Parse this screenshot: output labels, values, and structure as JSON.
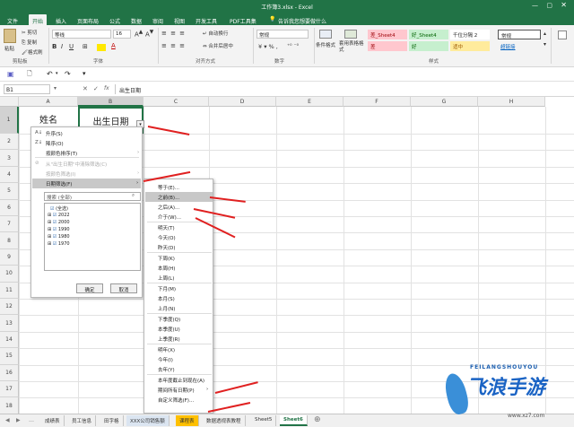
{
  "title": "工作簿3.xlsx - Excel",
  "menu": [
    "文件",
    "开始",
    "插入",
    "页面布局",
    "公式",
    "数据",
    "审阅",
    "视图",
    "开发工具",
    "PDF工具集"
  ],
  "tell_me": "告诉我您想要做什么",
  "ribbon": {
    "paste": "粘贴",
    "cut": "剪切",
    "copy": "复制",
    "format_painter": "格式刷",
    "clipboard": "剪贴板",
    "font_name": "等线",
    "font_size": "16",
    "font_group": "字体",
    "wrap": "自动换行",
    "merge": "合并后居中",
    "align_group": "对齐方式",
    "number_format": "常规",
    "number_group": "数字",
    "cond_format": "条件格式",
    "table_format": "套用表格格式",
    "styles_group": "样式",
    "styles": [
      "差_Sheet4",
      "好_Sheet4",
      "千位分隔 2",
      "常规",
      "差",
      "好",
      "适中",
      "超链接"
    ]
  },
  "name_box": "B1",
  "formula": "出生日期",
  "columns": [
    "A",
    "B",
    "C",
    "D",
    "E",
    "F",
    "G",
    "H"
  ],
  "rows": [
    "1",
    "2",
    "3",
    "4",
    "5",
    "6",
    "7",
    "8",
    "9",
    "10",
    "11",
    "12",
    "13",
    "14",
    "15",
    "16",
    "17",
    "18"
  ],
  "cells": {
    "a1": "姓名",
    "b1": "出生日期"
  },
  "filter_menu": {
    "sort_asc": "升序(S)",
    "sort_desc": "降序(O)",
    "sort_color": "按颜色排序(T)",
    "clear": "从\"出生日期\"中清除筛选(C)",
    "color_filter": "按颜色筛选(I)",
    "date_filter": "日期筛选(F)",
    "search_placeholder": "搜索 (全部)",
    "list": [
      "(全选)",
      "2022",
      "2000",
      "1990",
      "1980",
      "1970"
    ],
    "ok": "确定",
    "cancel": "取消"
  },
  "date_submenu": [
    "等于(E)...",
    "之前(B)...",
    "之后(A)...",
    "介于(W)...",
    "明天(T)",
    "今天(O)",
    "昨天(D)",
    "下周(K)",
    "本周(H)",
    "上周(L)",
    "下月(M)",
    "本月(S)",
    "上月(N)",
    "下季度(Q)",
    "本季度(U)",
    "上季度(R)",
    "明年(X)",
    "今年(I)",
    "去年(Y)",
    "本年度截止到现在(A)",
    "期间所有日期(P)",
    "自定义筛选(F)..."
  ],
  "sheet_tabs": [
    "成绩表",
    "员工信息",
    "田字格",
    "XXX公司销售额",
    "课程表",
    "数据透视表教程",
    "Sheet5",
    "Sheet6"
  ],
  "watermark": {
    "line1": "FEILANGSHOUYOU",
    "line2": "飞浪手游",
    "line3": "www.xz7.com"
  },
  "colors": {
    "excel_green": "#217346",
    "arrow": "#e02020",
    "bad_bg": "#ffc7ce",
    "good_bg": "#c6efce",
    "neutral_bg": "#ffeb9c"
  }
}
